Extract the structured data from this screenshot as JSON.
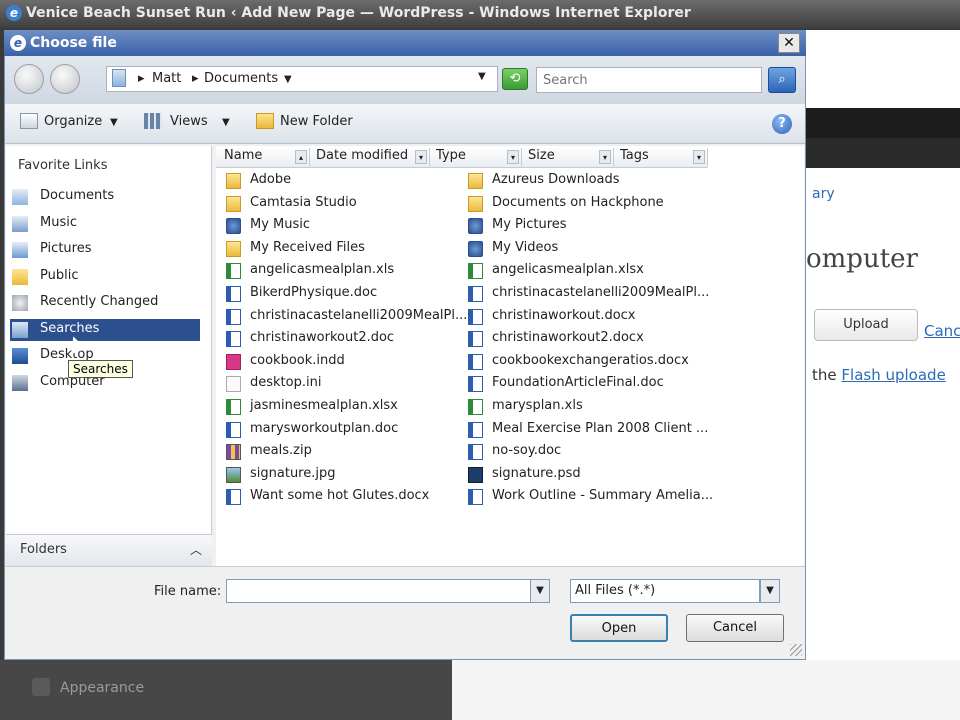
{
  "ie_window": {
    "title": "Venice Beach Sunset Run ‹ Add New Page — WordPress - Windows Internet Explorer"
  },
  "wordpress_bg": {
    "library_link": "ary",
    "heading": "omputer",
    "upload_button": "Upload",
    "cancel_link": "Canc",
    "text_prefix": "the",
    "flash_link": "Flash uploade",
    "appearance": "Appearance"
  },
  "dialog": {
    "title": "Choose file",
    "close_label": "✕",
    "breadcrumb": [
      "Matt",
      "Documents"
    ],
    "search_placeholder": "Search",
    "toolbar": {
      "organize": "Organize",
      "views": "Views",
      "new_folder": "New Folder"
    },
    "favorite_links_header": "Favorite Links",
    "favorite_links": [
      {
        "label": "Documents",
        "icon": "documents-icon"
      },
      {
        "label": "Music",
        "icon": "music-icon"
      },
      {
        "label": "Pictures",
        "icon": "pictures-icon"
      },
      {
        "label": "Public",
        "icon": "folder-icon"
      },
      {
        "label": "Recently Changed",
        "icon": "recent-icon"
      },
      {
        "label": "Searches",
        "icon": "searches-icon",
        "selected": true
      },
      {
        "label": "Desktop",
        "icon": "desktop-icon"
      },
      {
        "label": "Computer",
        "icon": "computer-icon"
      }
    ],
    "tooltip": "Searches",
    "folders_label": "Folders",
    "columns": [
      "Name",
      "Date modified",
      "Type",
      "Size",
      "Tags"
    ],
    "files_col1": [
      {
        "name": "Adobe",
        "type": "folder"
      },
      {
        "name": "Camtasia Studio",
        "type": "folder"
      },
      {
        "name": "My Music",
        "type": "special"
      },
      {
        "name": "My Received Files",
        "type": "folder"
      },
      {
        "name": "angelicasmealplan.xls",
        "type": "xls"
      },
      {
        "name": "BikerdPhysique.doc",
        "type": "doc"
      },
      {
        "name": "christinacastelanelli2009MealPl...",
        "type": "doc"
      },
      {
        "name": "christinaworkout2.doc",
        "type": "doc"
      },
      {
        "name": "cookbook.indd",
        "type": "indd"
      },
      {
        "name": "desktop.ini",
        "type": "ini"
      },
      {
        "name": "jasminesmealplan.xlsx",
        "type": "xls"
      },
      {
        "name": "marysworkoutplan.doc",
        "type": "doc"
      },
      {
        "name": "meals.zip",
        "type": "zip"
      },
      {
        "name": "signature.jpg",
        "type": "jpg"
      },
      {
        "name": "Want some hot Glutes.docx",
        "type": "doc"
      }
    ],
    "files_col2": [
      {
        "name": "Azureus Downloads",
        "type": "folder"
      },
      {
        "name": "Documents on Hackphone",
        "type": "folder"
      },
      {
        "name": "My Pictures",
        "type": "special"
      },
      {
        "name": "My Videos",
        "type": "special"
      },
      {
        "name": "angelicasmealplan.xlsx",
        "type": "xls"
      },
      {
        "name": "christinacastelanelli2009MealPl...",
        "type": "doc"
      },
      {
        "name": "christinaworkout.docx",
        "type": "doc"
      },
      {
        "name": "christinaworkout2.docx",
        "type": "doc"
      },
      {
        "name": "cookbookexchangeratios.docx",
        "type": "doc"
      },
      {
        "name": "FoundationArticleFinal.doc",
        "type": "doc"
      },
      {
        "name": "marysplan.xls",
        "type": "xls"
      },
      {
        "name": "Meal Exercise Plan 2008 Client ...",
        "type": "doc"
      },
      {
        "name": "no-soy.doc",
        "type": "doc"
      },
      {
        "name": "signature.psd",
        "type": "psd"
      },
      {
        "name": "Work Outline - Summary Amelia...",
        "type": "doc"
      }
    ],
    "file_name_label": "File name:",
    "file_name_value": "",
    "filter_value": "All Files (*.*)",
    "open_label": "Open",
    "cancel_label": "Cancel"
  }
}
